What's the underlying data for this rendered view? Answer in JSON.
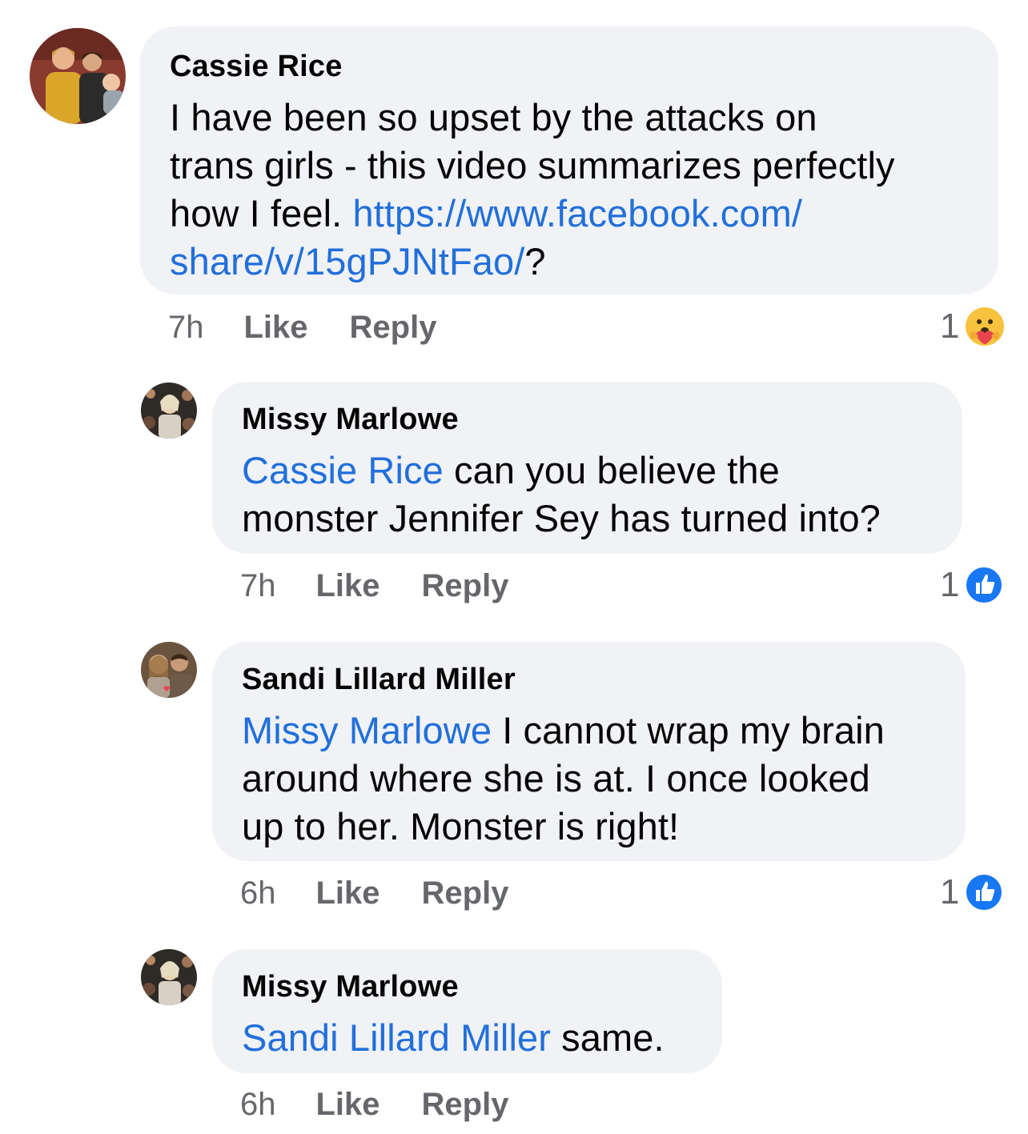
{
  "comments": [
    {
      "author": "Cassie Rice",
      "text_line1": "I have been so upset by the attacks on",
      "text_line2": "trans girls - this video summarizes perfectly",
      "text_line3_prefix": "how I feel. ",
      "link_part1": "https://www.facebook.com/",
      "link_part2": "share/v/15gPJNtFao/",
      "text_suffix": "?",
      "time": "7h",
      "like_label": "Like",
      "reply_label": "Reply",
      "reaction_count": "1",
      "reaction_icon": "care-emoji-icon"
    },
    {
      "author": "Missy Marlowe",
      "mention": "Cassie Rice",
      "text_line1": " can you believe the",
      "text_line2": "monster Jennifer Sey has turned into?",
      "time": "7h",
      "like_label": "Like",
      "reply_label": "Reply",
      "reaction_count": "1",
      "reaction_icon": "like-icon"
    },
    {
      "author": "Sandi Lillard Miller",
      "mention": "Missy Marlowe",
      "text_line1": " I cannot wrap my brain",
      "text_line2": "around where she is at. I once looked",
      "text_line3": "up to her. Monster is right!",
      "time": "6h",
      "like_label": "Like",
      "reply_label": "Reply",
      "reaction_count": "1",
      "reaction_icon": "like-icon"
    },
    {
      "author": "Missy Marlowe",
      "mention": "Sandi Lillard Miller",
      "text_line1": " same.",
      "time": "6h",
      "like_label": "Like",
      "reply_label": "Reply"
    }
  ],
  "colors": {
    "bubble": "#f0f2f5",
    "link": "#216fdb",
    "meta": "#65676b",
    "like_blue": "#1877f2"
  }
}
